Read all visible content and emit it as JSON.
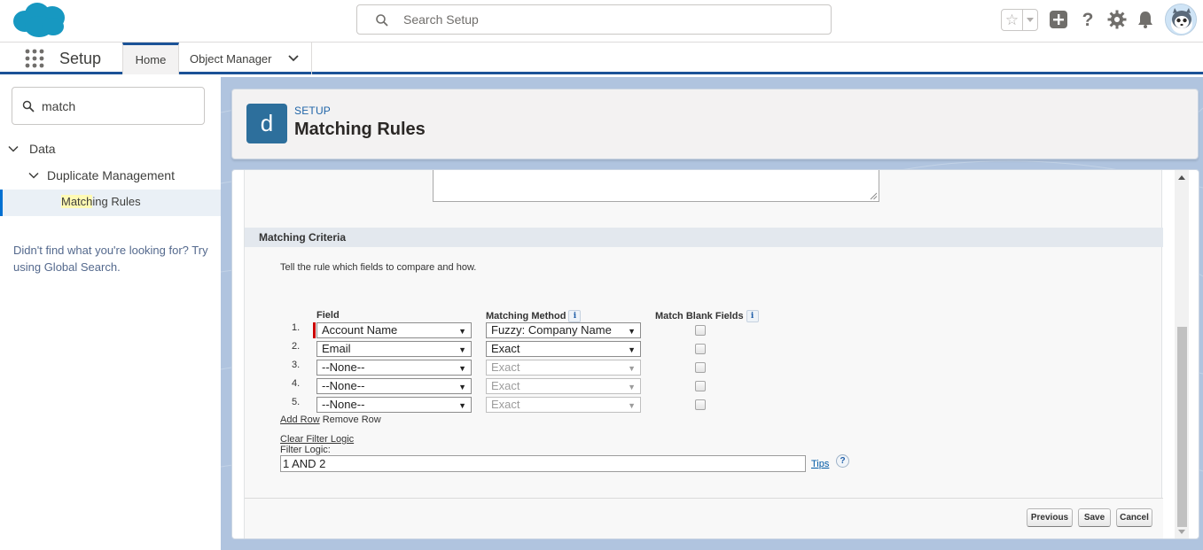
{
  "header": {
    "search_placeholder": "Search Setup",
    "icons": [
      "salesforce-logo",
      "search-icon",
      "favorites-star-icon",
      "favorites-dropdown-icon",
      "global-actions-add-icon",
      "help-icon",
      "setup-gear-icon",
      "notifications-bell-icon",
      "user-avatar"
    ]
  },
  "nav": {
    "app_name": "Setup",
    "tabs": [
      {
        "label": "Home",
        "active": true
      },
      {
        "label": "Object Manager",
        "has_dropdown": true
      }
    ]
  },
  "sidebar": {
    "quick_find_value": "match",
    "tree": [
      {
        "label": "Data",
        "level": 0,
        "expanded": true
      },
      {
        "label": "Duplicate Management",
        "level": 1,
        "expanded": true
      },
      {
        "label_highlight": "Match",
        "label_rest": "ing Rules",
        "level": 2,
        "selected": true
      }
    ],
    "not_found_text": "Didn't find what you're looking for? Try using Global Search."
  },
  "page_header": {
    "tile_letter": "d",
    "eyebrow": "SETUP",
    "title": "Matching Rules"
  },
  "form": {
    "section_title": "Matching Criteria",
    "help_text": "Tell the rule which fields to compare and how.",
    "columns": {
      "field": "Field",
      "method": "Matching Method",
      "blank": "Match Blank Fields",
      "info_icon": "i"
    },
    "rows": [
      {
        "num": "1.",
        "field": "Account Name",
        "method": "Fuzzy: Company Name",
        "method_enabled": true,
        "required": true,
        "match_blank": false
      },
      {
        "num": "2.",
        "field": "Email",
        "method": "Exact",
        "method_enabled": true,
        "required": false,
        "match_blank": false
      },
      {
        "num": "3.",
        "field": "--None--",
        "method": "Exact",
        "method_enabled": false,
        "required": false,
        "match_blank": false
      },
      {
        "num": "4.",
        "field": "--None--",
        "method": "Exact",
        "method_enabled": false,
        "required": false,
        "match_blank": false
      },
      {
        "num": "5.",
        "field": "--None--",
        "method": "Exact",
        "method_enabled": false,
        "required": false,
        "match_blank": false
      }
    ],
    "add_row": "Add Row",
    "remove_row": "Remove Row",
    "clear_filter_logic": "Clear Filter Logic",
    "filter_logic_label": "Filter Logic:",
    "filter_logic_value": "1 AND 2",
    "tips": "Tips",
    "help_icon": "?"
  },
  "buttons": {
    "previous": "Previous",
    "save": "Save",
    "cancel": "Cancel"
  },
  "colors": {
    "brand_blue": "#1b5297",
    "tile": "#2d6f9c",
    "link": "#015ba7",
    "required": "#cc0000",
    "highlight": "#fffab4",
    "background_pattern": "#b0c4df"
  }
}
